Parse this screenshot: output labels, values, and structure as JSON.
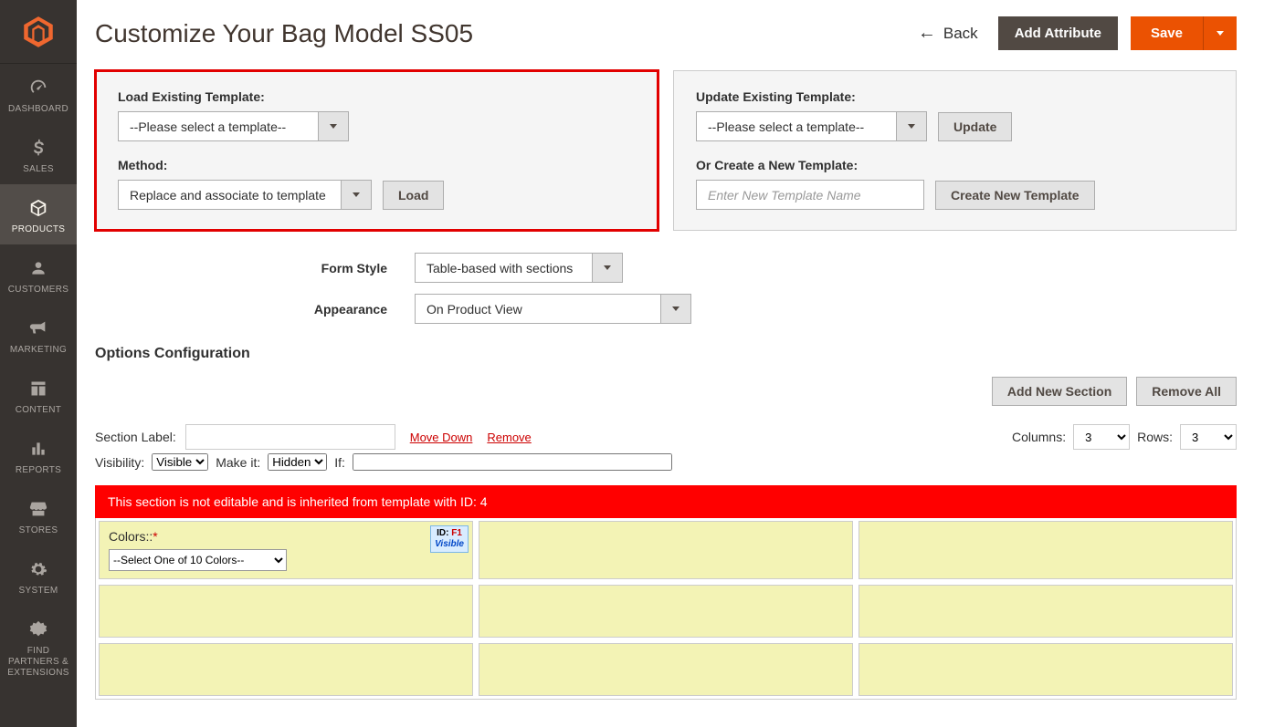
{
  "page_title": "Customize Your Bag Model SS05",
  "header": {
    "back": "Back",
    "add_attribute": "Add Attribute",
    "save": "Save"
  },
  "sidebar": {
    "items": [
      {
        "label": "DASHBOARD"
      },
      {
        "label": "SALES"
      },
      {
        "label": "PRODUCTS"
      },
      {
        "label": "CUSTOMERS"
      },
      {
        "label": "MARKETING"
      },
      {
        "label": "CONTENT"
      },
      {
        "label": "REPORTS"
      },
      {
        "label": "STORES"
      },
      {
        "label": "SYSTEM"
      },
      {
        "label": "FIND PARTNERS & EXTENSIONS"
      }
    ]
  },
  "templates": {
    "load_label": "Load Existing Template:",
    "load_placeholder": "--Please select a template--",
    "method_label": "Method:",
    "method_value": "Replace and associate to template",
    "load_btn": "Load",
    "update_label": "Update Existing Template:",
    "update_placeholder": "--Please select a template--",
    "update_btn": "Update",
    "create_label": "Or Create a New Template:",
    "create_placeholder": "Enter New Template Name",
    "create_btn": "Create New Template"
  },
  "form": {
    "style_label": "Form Style",
    "style_value": "Table-based with sections",
    "appearance_label": "Appearance",
    "appearance_value": "On Product View"
  },
  "options_heading": "Options Configuration",
  "section_actions": {
    "add": "Add New Section",
    "remove_all": "Remove All"
  },
  "section": {
    "label_text": "Section Label:",
    "move_down": "Move Down",
    "remove": "Remove",
    "columns_label": "Columns:",
    "columns_value": "3",
    "rows_label": "Rows:",
    "rows_value": "3",
    "visibility_label": "Visibility:",
    "visibility_value": "Visible",
    "makeit_label": "Make it:",
    "makeit_value": "Hidden",
    "if_label": "If:"
  },
  "banner": "This section is not editable and is inherited from template with ID: 4",
  "cell": {
    "title": "Colors::",
    "select_value": "--Select One of 10 Colors--",
    "badge_id": "ID:",
    "badge_fid": "F1",
    "badge_vis": "Visible"
  }
}
